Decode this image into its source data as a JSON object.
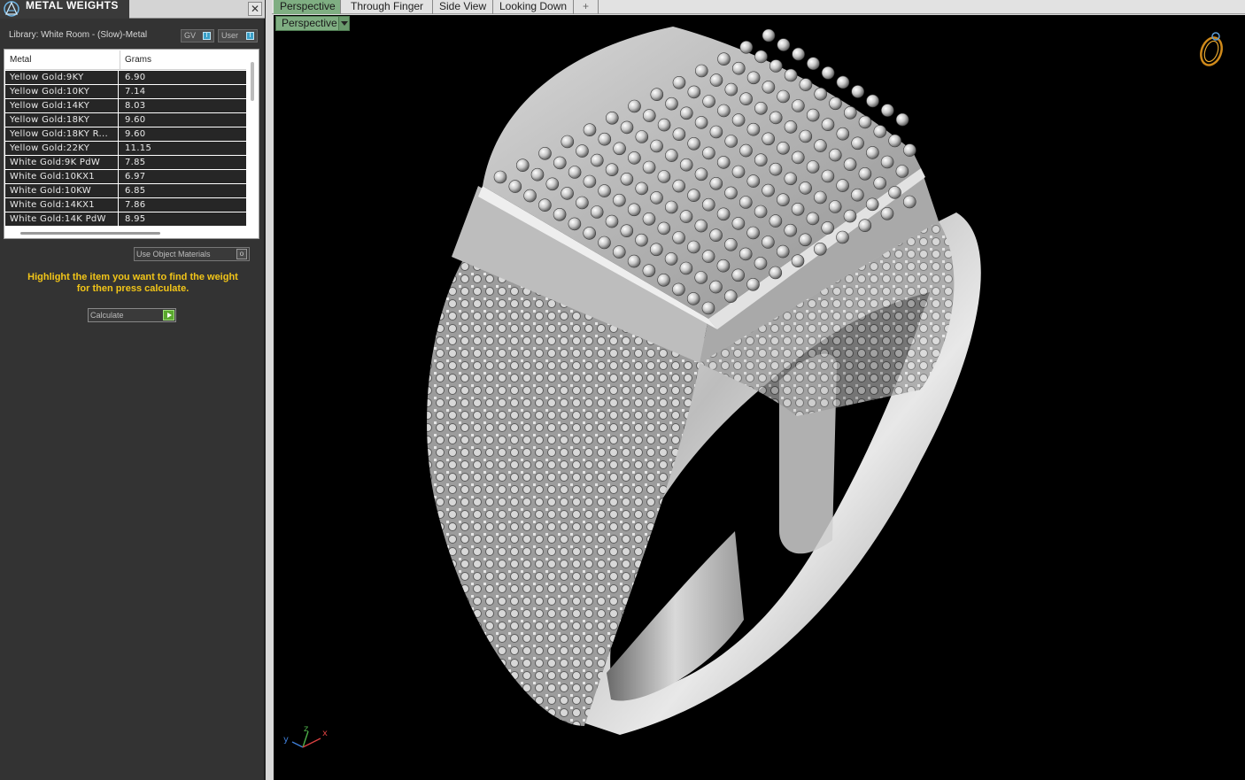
{
  "panel": {
    "title": "METAL WEIGHTS",
    "close": "✕",
    "library_label": "Library: White Room - (Slow)-Metal",
    "gv_label": "GV",
    "user_label": "User",
    "table": {
      "col_metal": "Metal",
      "col_grams": "Grams",
      "rows": [
        {
          "metal": "Yellow Gold:9KY",
          "grams": "6.90"
        },
        {
          "metal": "Yellow Gold:10KY",
          "grams": "7.14"
        },
        {
          "metal": "Yellow Gold:14KY",
          "grams": "8.03"
        },
        {
          "metal": "Yellow Gold:18KY",
          "grams": "9.60"
        },
        {
          "metal": "Yellow Gold:18KY R...",
          "grams": "9.60"
        },
        {
          "metal": "Yellow Gold:22KY",
          "grams": "11.15"
        },
        {
          "metal": "White Gold:9K PdW",
          "grams": "7.85"
        },
        {
          "metal": "White Gold:10KX1",
          "grams": "6.97"
        },
        {
          "metal": "White Gold:10KW",
          "grams": "6.85"
        },
        {
          "metal": "White Gold:14KX1",
          "grams": "7.86"
        },
        {
          "metal": "White Gold:14K PdW",
          "grams": "8.95"
        }
      ]
    },
    "use_object_materials": "Use Object Materials",
    "instruction_line1": "Highlight the item you want to find the weight",
    "instruction_line2": "for then press calculate.",
    "calculate": "Calculate"
  },
  "viewport": {
    "tabs": [
      {
        "label": "Perspective",
        "active": true
      },
      {
        "label": "Through Finger",
        "active": false
      },
      {
        "label": "Side View",
        "active": false
      },
      {
        "label": "Looking Down",
        "active": false
      },
      {
        "label": "+",
        "active": false
      }
    ],
    "view_dropdown": "Perspective",
    "axis": {
      "x": "x",
      "y": "y",
      "z": "z"
    }
  },
  "colors": {
    "active_tab": "#7fae82",
    "instruction": "#f2c518",
    "calculate_play": "#5aa82e"
  }
}
